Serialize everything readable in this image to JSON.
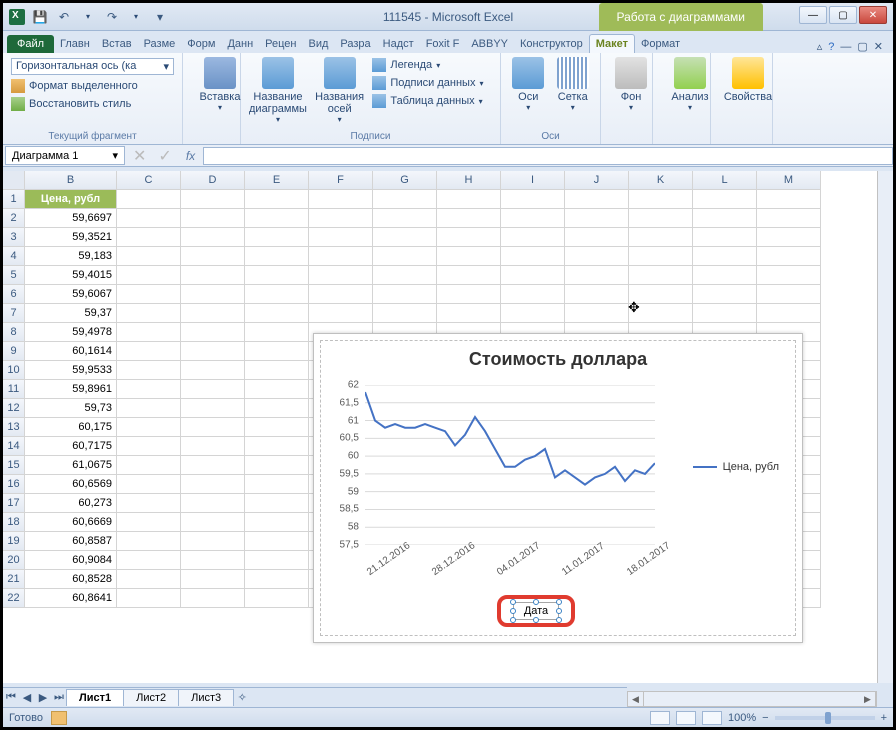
{
  "window": {
    "title": "111545 - Microsoft Excel",
    "chart_tools_title": "Работа с диаграммами"
  },
  "qat": {
    "save": "💾",
    "undo": "↶",
    "redo": "↷"
  },
  "tabs": {
    "file": "Файл",
    "items": [
      "Главн",
      "Встав",
      "Разме",
      "Форм",
      "Данн",
      "Рецен",
      "Вид",
      "Разра",
      "Надст",
      "Foxit F",
      "ABBYY"
    ],
    "contextual": [
      "Конструктор",
      "Макет",
      "Формат"
    ],
    "active_contextual": "Макет"
  },
  "ribbon": {
    "current_fragment": {
      "selector": "Горизонтальная ось (ка",
      "format_sel": "Формат выделенного",
      "reset_style": "Восстановить стиль",
      "title": "Текущий фрагмент"
    },
    "insert": {
      "label": "Вставка"
    },
    "labels_group": {
      "chart_title": "Название диаграммы",
      "axis_titles": "Названия осей",
      "legend": "Легенда",
      "data_labels": "Подписи данных",
      "data_table": "Таблица данных",
      "title": "Подписи"
    },
    "axes_group": {
      "axes": "Оси",
      "grid": "Сетка",
      "title": "Оси"
    },
    "bg_group": {
      "label": "Фон"
    },
    "analysis": {
      "label": "Анализ"
    },
    "props": {
      "label": "Свойства"
    }
  },
  "namebox": "Диаграмма 1",
  "fx_label": "fx",
  "columns": [
    "B",
    "C",
    "D",
    "E",
    "F",
    "G",
    "H",
    "I",
    "J",
    "K",
    "L",
    "M"
  ],
  "rows": [
    "1",
    "2",
    "3",
    "4",
    "5",
    "6",
    "7",
    "8",
    "9",
    "10",
    "11",
    "12",
    "13",
    "14",
    "15",
    "16",
    "17",
    "18",
    "19",
    "20",
    "21",
    "22"
  ],
  "data_header": "Цена, рубл",
  "data_values": [
    "59,6697",
    "59,3521",
    "59,183",
    "59,4015",
    "59,6067",
    "59,37",
    "59,4978",
    "60,1614",
    "59,9533",
    "59,8961",
    "59,73",
    "60,175",
    "60,7175",
    "61,0675",
    "60,6569",
    "60,273",
    "60,6669",
    "60,8587",
    "60,9084",
    "60,8528",
    "60,8641"
  ],
  "chart": {
    "title": "Стоимость доллара",
    "legend": "Цена, рубл",
    "axis_label": "Дата",
    "y_ticks": [
      "57,5",
      "58",
      "58,5",
      "59",
      "59,5",
      "60",
      "60,5",
      "61",
      "61,5",
      "62"
    ],
    "x_ticks": [
      "21.12.2016",
      "28.12.2016",
      "04.01.2017",
      "11.01.2017",
      "18.01.2017"
    ]
  },
  "sheets": {
    "items": [
      "Лист1",
      "Лист2",
      "Лист3"
    ],
    "active": "Лист1"
  },
  "status": {
    "ready": "Готово",
    "zoom": "100%"
  },
  "chart_data": {
    "type": "line",
    "title": "Стоимость доллара",
    "xlabel": "Дата",
    "ylabel": "",
    "ylim": [
      57.5,
      62
    ],
    "x": [
      "21.12.2016",
      "28.12.2016",
      "04.01.2017",
      "11.01.2017",
      "18.01.2017"
    ],
    "series": [
      {
        "name": "Цена, рубл",
        "values": [
          61.8,
          61.0,
          60.8,
          60.9,
          60.8,
          60.8,
          60.9,
          60.8,
          60.7,
          60.3,
          60.6,
          61.1,
          60.7,
          60.2,
          59.7,
          59.7,
          59.9,
          60.0,
          60.2,
          59.4,
          59.6,
          59.4,
          59.2,
          59.4,
          59.5,
          59.7,
          59.3,
          59.6,
          59.5,
          59.8
        ]
      }
    ]
  }
}
